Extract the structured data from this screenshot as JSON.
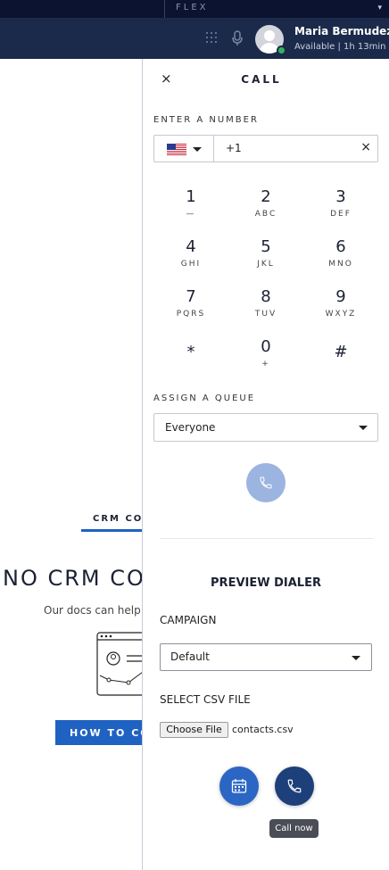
{
  "topbar": {
    "brand": "FLEX",
    "chevron": "▾"
  },
  "header": {
    "user_name": "Maria Bermudez",
    "user_status": "Available | 1h 13min",
    "status_color": "#2fb465",
    "icons": [
      "dialpad-icon",
      "microphone-icon"
    ]
  },
  "background": {
    "tab_label": "CRM CON",
    "title": "NO CRM CON",
    "subtitle": "Our docs can help y",
    "button_label": "HOW TO CON"
  },
  "panel": {
    "close_label": "×",
    "title": "CALL",
    "enter_number_label": "ENTER A NUMBER",
    "country_flag": "us-flag",
    "number_value": "+1",
    "clear_label": "×",
    "keypad": [
      {
        "digit": "1",
        "letters": "—"
      },
      {
        "digit": "2",
        "letters": "ABC"
      },
      {
        "digit": "3",
        "letters": "DEF"
      },
      {
        "digit": "4",
        "letters": "GHI"
      },
      {
        "digit": "5",
        "letters": "JKL"
      },
      {
        "digit": "6",
        "letters": "MNO"
      },
      {
        "digit": "7",
        "letters": "PQRS"
      },
      {
        "digit": "8",
        "letters": "TUV"
      },
      {
        "digit": "9",
        "letters": "WXYZ"
      },
      {
        "digit": "*",
        "letters": ""
      },
      {
        "digit": "0",
        "letters": "+"
      },
      {
        "digit": "#",
        "letters": ""
      }
    ],
    "queue_label": "ASSIGN A QUEUE",
    "queue_value": "Everyone",
    "call_button_color": "#9cb4e0",
    "preview_title": "PREVIEW DIALER",
    "campaign_label": "CAMPAIGN",
    "campaign_value": "Default",
    "csv_label": "SELECT CSV FILE",
    "choose_file_label": "Choose File",
    "file_name": "contacts.csv",
    "schedule_button_color": "#2b66c4",
    "call_now_button_color": "#1d3f7a",
    "call_now_tooltip": "Call now"
  }
}
